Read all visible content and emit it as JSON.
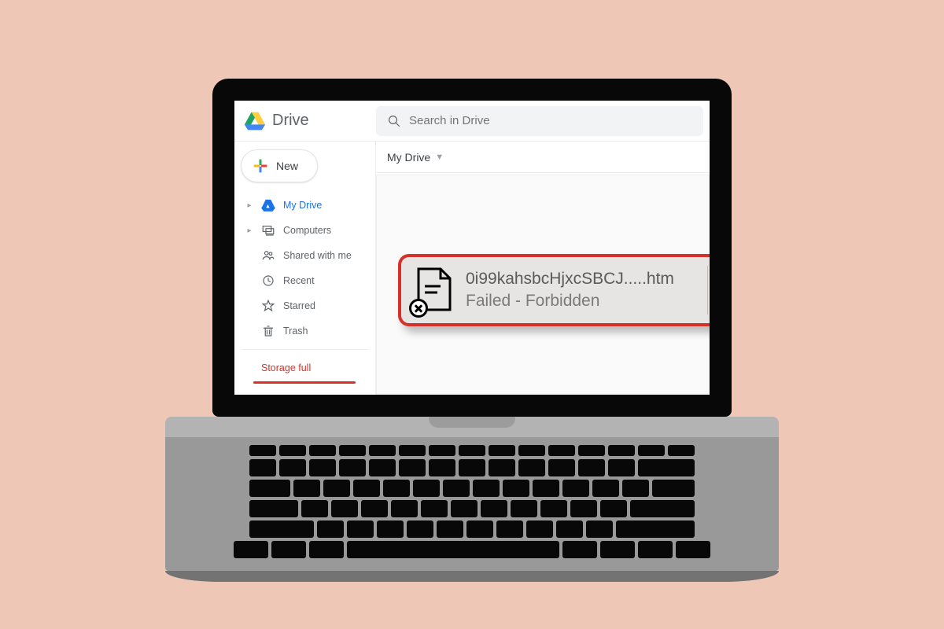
{
  "brand": {
    "name": "Drive"
  },
  "search": {
    "placeholder": "Search in Drive"
  },
  "new_button": {
    "label": "New"
  },
  "sidebar": {
    "items": [
      {
        "label": "My Drive",
        "icon": "drive-icon",
        "has_caret": true,
        "active": true
      },
      {
        "label": "Computers",
        "icon": "computers-icon",
        "has_caret": true,
        "active": false
      },
      {
        "label": "Shared with me",
        "icon": "shared-icon",
        "has_caret": false,
        "active": false
      },
      {
        "label": "Recent",
        "icon": "recent-icon",
        "has_caret": false,
        "active": false
      },
      {
        "label": "Starred",
        "icon": "star-icon",
        "has_caret": false,
        "active": false
      },
      {
        "label": "Trash",
        "icon": "trash-icon",
        "has_caret": false,
        "active": false
      }
    ],
    "storage_label": "Storage full"
  },
  "breadcrumb": {
    "root": "My Drive"
  },
  "download_error": {
    "filename": "0i99kahsbcHjxcSBCJ.....htm",
    "status": "Failed - Forbidden"
  }
}
